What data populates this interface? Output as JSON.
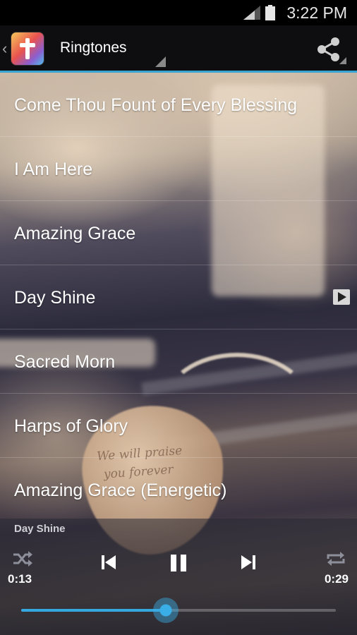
{
  "status_bar": {
    "time": "3:22 PM"
  },
  "app_bar": {
    "title": "Ringtones"
  },
  "ringtones": [
    {
      "label": "Come Thou Fount of Every Blessing",
      "playing": false
    },
    {
      "label": "I Am Here",
      "playing": false
    },
    {
      "label": "Amazing Grace",
      "playing": false
    },
    {
      "label": "Day Shine",
      "playing": true
    },
    {
      "label": "Sacred Morn",
      "playing": false
    },
    {
      "label": "Harps of Glory",
      "playing": false
    },
    {
      "label": "Amazing Grace (Energetic)",
      "playing": false
    }
  ],
  "player": {
    "now_playing": "Day Shine",
    "elapsed": "0:13",
    "duration": "0:29",
    "progress": 0.46
  },
  "background_text": [
    "We will praise",
    "you forever"
  ],
  "colors": {
    "accent": "#38a4d4",
    "status_bar": "#000000",
    "action_bar": "#0e0e10"
  },
  "icons": [
    "back-chevron-icon",
    "app-icon",
    "share-icon",
    "signal-icon",
    "battery-icon",
    "play-indicator-icon",
    "shuffle-icon",
    "previous-icon",
    "pause-icon",
    "next-icon",
    "repeat-icon"
  ]
}
